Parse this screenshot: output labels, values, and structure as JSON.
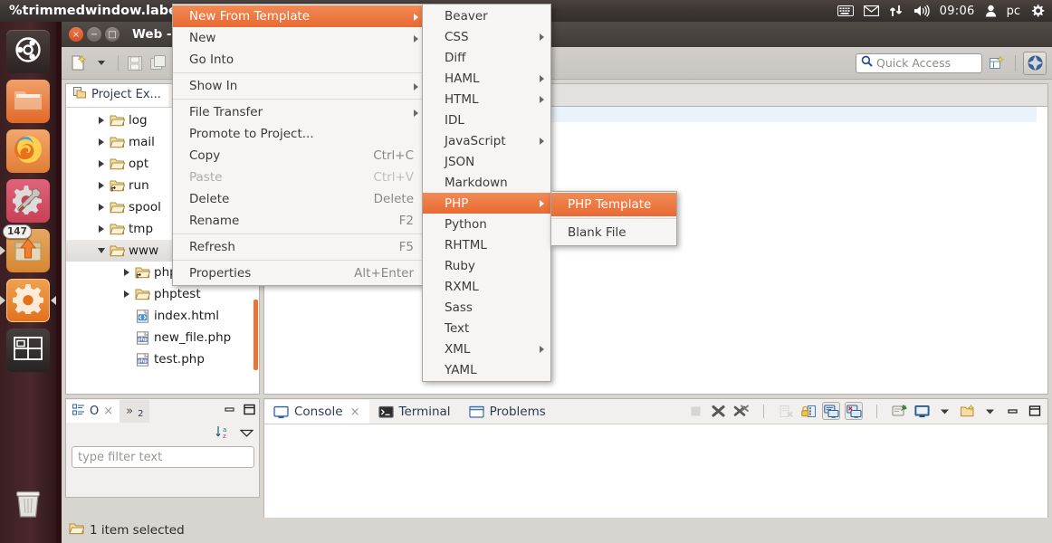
{
  "top_panel": {
    "window_title": "%trimmedwindow.label.e",
    "tray": {
      "keyboard_icon": "keyboard-icon",
      "mail_icon": "envelope-icon",
      "network_icon": "network-updown-icon",
      "volume_icon": "volume-icon",
      "clock": "09:06",
      "user_icon": "user-icon",
      "username": "pc",
      "settings_icon": "gear-icon"
    }
  },
  "launcher": {
    "items": [
      {
        "name": "ubuntu-dash",
        "icon": "ubuntu-logo-icon",
        "badge": "",
        "running": false
      },
      {
        "name": "files",
        "icon": "folder-icon",
        "badge": "",
        "running": false
      },
      {
        "name": "firefox",
        "icon": "firefox-icon",
        "badge": "",
        "running": false
      },
      {
        "name": "system-tools",
        "icon": "gear-wrench-icon",
        "badge": "",
        "running": false
      },
      {
        "name": "software-updater",
        "icon": "box-up-arrow-icon",
        "badge": "147",
        "running": true
      },
      {
        "name": "system-settings",
        "icon": "gear-icon",
        "badge": "",
        "running": true
      },
      {
        "name": "workspace-switcher",
        "icon": "workspaces-icon",
        "badge": "",
        "running": false
      }
    ],
    "trash": {
      "name": "trash",
      "icon": "trash-icon"
    }
  },
  "window": {
    "title": "Web - ",
    "close_label": "×",
    "minimize_label": "−",
    "maximize_label": "□"
  },
  "toolbar": {
    "buttons": [
      {
        "name": "new-wizard-button",
        "icon": "new-file-icon"
      },
      {
        "name": "new-wizard-dropdown",
        "icon": "chevron-down-icon"
      },
      {
        "name": "save-button",
        "icon": "save-icon"
      },
      {
        "name": "save-all-button",
        "icon": "save-all-icon"
      },
      {
        "name": "print-button",
        "icon": "print-icon"
      },
      {
        "name": "toggle-markoccurrences-button",
        "icon": "marker-icon"
      },
      {
        "name": "show-whitespace-button",
        "icon": "pilcrow-icon"
      },
      {
        "name": "back-button",
        "icon": "arrow-left-icon"
      },
      {
        "name": "back-dropdown",
        "icon": "chevron-down-icon"
      },
      {
        "name": "forward-button",
        "icon": "arrow-right-icon"
      },
      {
        "name": "forward-dropdown",
        "icon": "chevron-down-icon"
      },
      {
        "name": "open-task-button",
        "icon": "task-icon"
      }
    ],
    "quick_access": {
      "placeholder": "Quick Access",
      "search_icon": "search-icon"
    },
    "new_perspective_icon": "new-perspective-icon",
    "perspective_switch_icon": "perspective-web-icon"
  },
  "project_explorer": {
    "tab_label": "Project Ex...",
    "tab_icon": "project-explorer-icon",
    "tree": [
      {
        "label": "log",
        "indent": 1,
        "twisty": "right",
        "icon": "folder-icon",
        "selected": false
      },
      {
        "label": "mail",
        "indent": 1,
        "twisty": "right",
        "icon": "folder-icon",
        "selected": false
      },
      {
        "label": "opt",
        "indent": 1,
        "twisty": "right",
        "icon": "folder-icon",
        "selected": false
      },
      {
        "label": "run",
        "indent": 1,
        "twisty": "right",
        "icon": "folder-link-icon",
        "selected": false
      },
      {
        "label": "spool",
        "indent": 1,
        "twisty": "right",
        "icon": "folder-icon",
        "selected": false
      },
      {
        "label": "tmp",
        "indent": 1,
        "twisty": "right",
        "icon": "folder-icon",
        "selected": false
      },
      {
        "label": "www",
        "indent": 1,
        "twisty": "down",
        "icon": "folder-icon",
        "selected": true
      },
      {
        "label": "phpmyadmin",
        "indent": 2,
        "twisty": "right",
        "icon": "folder-link-icon",
        "selected": false
      },
      {
        "label": "phptest",
        "indent": 2,
        "twisty": "right",
        "icon": "folder-icon",
        "selected": false
      },
      {
        "label": "index.html",
        "indent": 2,
        "twisty": "none",
        "icon": "html-file-icon",
        "selected": false
      },
      {
        "label": "new_file.php",
        "indent": 2,
        "twisty": "none",
        "icon": "php-file-icon",
        "selected": false
      },
      {
        "label": "test.php",
        "indent": 2,
        "twisty": "none",
        "icon": "php-file-icon",
        "selected": false
      }
    ]
  },
  "outline": {
    "tab_label": "O",
    "tab_icon": "outline-icon",
    "close_label": "×",
    "overflow_tab_label": "2",
    "overflow_tab_icon": "chevrons-right-icon",
    "minimize_icon": "minimize-icon",
    "maximize_icon": "maximize-icon",
    "sort_icon": "sort-az-icon",
    "view-menu_icon": "view-menu-icon",
    "filter_placeholder": "type filter text"
  },
  "console": {
    "tabs": [
      {
        "label": "Console",
        "icon": "console-icon",
        "active": true,
        "closable": true
      },
      {
        "label": "Terminal",
        "icon": "terminal-icon",
        "active": false,
        "closable": false
      },
      {
        "label": "Problems",
        "icon": "problems-icon",
        "active": false,
        "closable": false
      }
    ],
    "close_label": "×",
    "tools": [
      {
        "name": "terminate-button",
        "icon": "stop-square-icon",
        "enabled": false,
        "boxed": false
      },
      {
        "name": "remove-launch-button",
        "icon": "remove-x-icon",
        "enabled": true,
        "boxed": false
      },
      {
        "name": "remove-all-launches-button",
        "icon": "remove-all-x-icon",
        "enabled": true,
        "boxed": false
      },
      {
        "name": "separator-1",
        "icon": "separator",
        "enabled": true,
        "boxed": false
      },
      {
        "name": "clear-console-button",
        "icon": "clear-console-icon",
        "enabled": false,
        "boxed": false
      },
      {
        "name": "scroll-lock-button",
        "icon": "scroll-lock-icon",
        "enabled": true,
        "boxed": false
      },
      {
        "name": "show-console-on-output-button",
        "icon": "console-out-icon",
        "enabled": true,
        "boxed": true
      },
      {
        "name": "show-console-on-error-button",
        "icon": "console-err-icon",
        "enabled": true,
        "boxed": true
      },
      {
        "name": "separator-2",
        "icon": "separator",
        "enabled": true,
        "boxed": false
      },
      {
        "name": "pin-console-button",
        "icon": "pin-console-icon",
        "enabled": true,
        "boxed": false
      },
      {
        "name": "display-console-button",
        "icon": "display-console-icon",
        "enabled": true,
        "boxed": false
      },
      {
        "name": "display-console-dropdown",
        "icon": "chevron-down-icon",
        "enabled": true,
        "boxed": false
      },
      {
        "name": "open-console-button",
        "icon": "new-console-icon",
        "enabled": true,
        "boxed": false
      },
      {
        "name": "open-console-dropdown",
        "icon": "chevron-down-icon",
        "enabled": true,
        "boxed": false
      },
      {
        "name": "minimize-console-button",
        "icon": "minimize-icon",
        "enabled": true,
        "boxed": false
      },
      {
        "name": "maximize-console-button",
        "icon": "maximize-icon",
        "enabled": true,
        "boxed": false
      }
    ]
  },
  "statusbar": {
    "icon": "folder-icon",
    "text": "1 item selected"
  },
  "context_menu": {
    "items": [
      {
        "label": "New From Template",
        "accel": "",
        "submenu": true,
        "highlighted": true,
        "disabled": false,
        "separator_after": false
      },
      {
        "label": "New",
        "accel": "",
        "submenu": true,
        "highlighted": false,
        "disabled": false,
        "separator_after": false
      },
      {
        "label": "Go Into",
        "accel": "",
        "submenu": false,
        "highlighted": false,
        "disabled": false,
        "separator_after": true
      },
      {
        "label": "Show In",
        "accel": "",
        "submenu": true,
        "highlighted": false,
        "disabled": false,
        "separator_after": true
      },
      {
        "label": "File Transfer",
        "accel": "",
        "submenu": true,
        "highlighted": false,
        "disabled": false,
        "separator_after": false
      },
      {
        "label": "Promote to Project...",
        "accel": "",
        "submenu": false,
        "highlighted": false,
        "disabled": false,
        "separator_after": false
      },
      {
        "label": "Copy",
        "accel": "Ctrl+C",
        "submenu": false,
        "highlighted": false,
        "disabled": false,
        "separator_after": false
      },
      {
        "label": "Paste",
        "accel": "Ctrl+V",
        "submenu": false,
        "highlighted": false,
        "disabled": true,
        "separator_after": false
      },
      {
        "label": "Delete",
        "accel": "Delete",
        "submenu": false,
        "highlighted": false,
        "disabled": false,
        "separator_after": false
      },
      {
        "label": "Rename",
        "accel": "F2",
        "submenu": false,
        "highlighted": false,
        "disabled": false,
        "separator_after": true
      },
      {
        "label": "Refresh",
        "accel": "F5",
        "submenu": false,
        "highlighted": false,
        "disabled": false,
        "separator_after": true
      },
      {
        "label": "Properties",
        "accel": "Alt+Enter",
        "submenu": false,
        "highlighted": false,
        "disabled": false,
        "separator_after": false
      }
    ]
  },
  "template_menu": {
    "items": [
      {
        "label": "Beaver",
        "submenu": false,
        "highlighted": false
      },
      {
        "label": "CSS",
        "submenu": true,
        "highlighted": false
      },
      {
        "label": "Diff",
        "submenu": false,
        "highlighted": false
      },
      {
        "label": "HAML",
        "submenu": true,
        "highlighted": false
      },
      {
        "label": "HTML",
        "submenu": true,
        "highlighted": false
      },
      {
        "label": "IDL",
        "submenu": false,
        "highlighted": false
      },
      {
        "label": "JavaScript",
        "submenu": true,
        "highlighted": false
      },
      {
        "label": "JSON",
        "submenu": false,
        "highlighted": false
      },
      {
        "label": "Markdown",
        "submenu": false,
        "highlighted": false
      },
      {
        "label": "PHP",
        "submenu": true,
        "highlighted": true
      },
      {
        "label": "Python",
        "submenu": false,
        "highlighted": false
      },
      {
        "label": "RHTML",
        "submenu": false,
        "highlighted": false
      },
      {
        "label": "Ruby",
        "submenu": false,
        "highlighted": false
      },
      {
        "label": "RXML",
        "submenu": false,
        "highlighted": false
      },
      {
        "label": "Sass",
        "submenu": false,
        "highlighted": false
      },
      {
        "label": "Text",
        "submenu": false,
        "highlighted": false
      },
      {
        "label": "XML",
        "submenu": true,
        "highlighted": false
      },
      {
        "label": "YAML",
        "submenu": false,
        "highlighted": false
      }
    ]
  },
  "php_menu": {
    "items": [
      {
        "label": "PHP Template",
        "highlighted": true,
        "separator_after": true
      },
      {
        "label": "Blank File",
        "highlighted": false,
        "separator_after": false
      }
    ]
  },
  "colors": {
    "accent_orange": "#e86a33",
    "highlight_gradient_top": "#f28a55",
    "menu_bg": "#f6f5f4",
    "panel_bg": "#d8d4d0",
    "editor_selection": "#eaf2fb",
    "launcher_bg": "#3b1f23"
  }
}
